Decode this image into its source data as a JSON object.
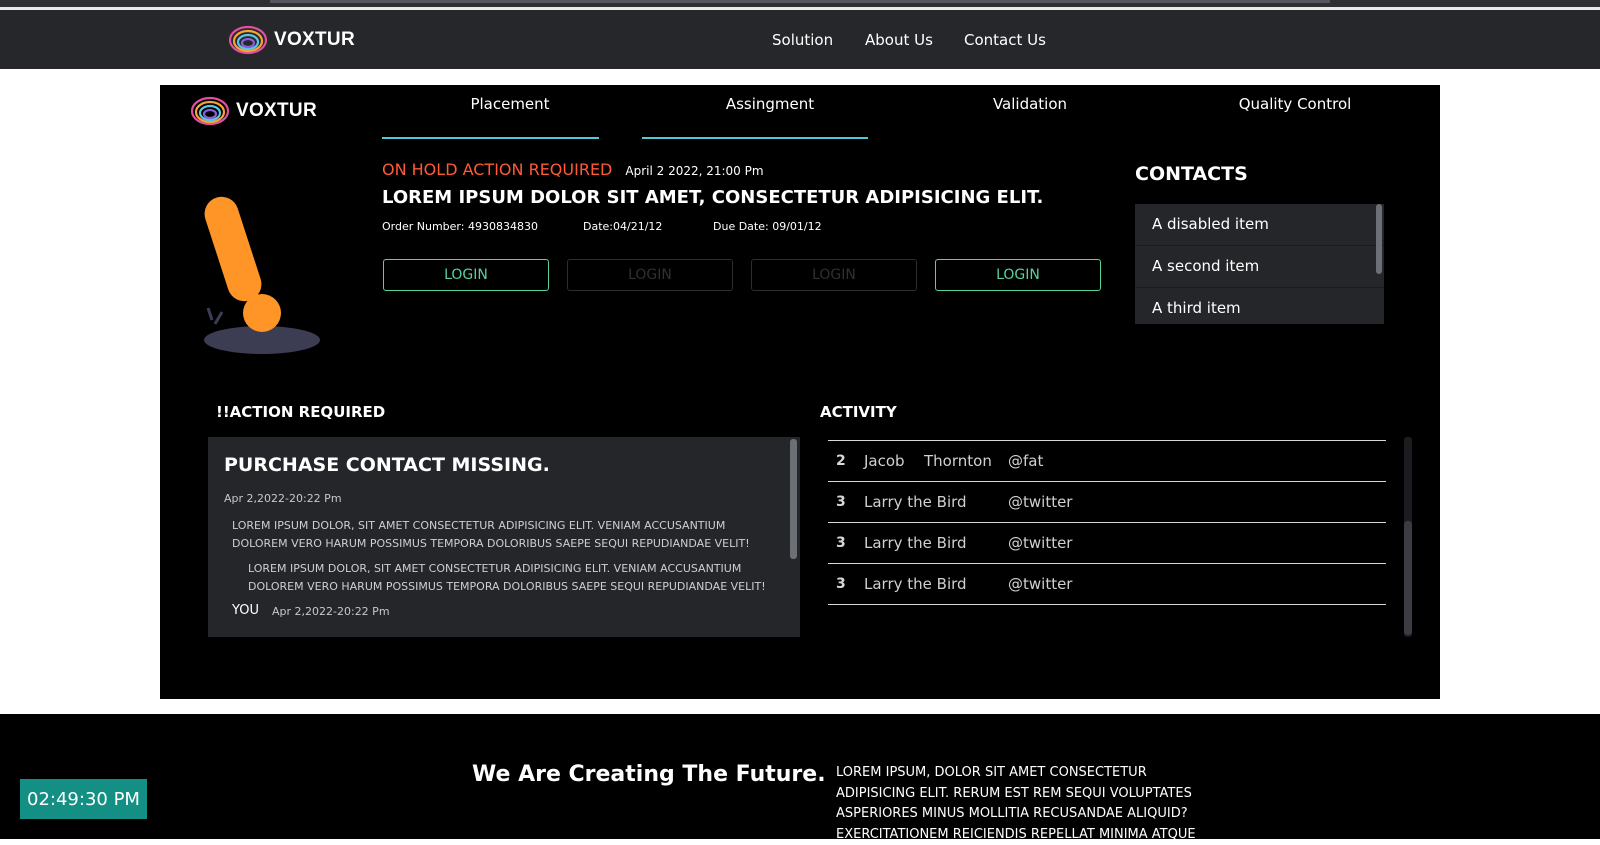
{
  "site": {
    "brand": "VOXTUR",
    "nav": [
      "Solution",
      "About Us",
      "Contact Us"
    ]
  },
  "card": {
    "brand": "VOXTUR",
    "tabs": [
      "Placement",
      "Assingment",
      "Validation",
      "Quality Control"
    ],
    "status": "ON HOLD ACTION REQUIRED",
    "status_time": "April 2 2022, 21:00 Pm",
    "headline": "LOREM IPSUM DOLOR SIT AMET, CONSECTETUR ADIPISICING ELIT.",
    "order_number": "Order Number: 4930834830",
    "date": "Date:04/21/12",
    "due_date": "Due Date: 09/01/12",
    "buttons": [
      {
        "label": "LOGIN",
        "disabled": false
      },
      {
        "label": "LOGIN",
        "disabled": true
      },
      {
        "label": "LOGIN",
        "disabled": true
      },
      {
        "label": "LOGIN",
        "disabled": false
      }
    ],
    "contacts": {
      "title": "CONTACTS",
      "items": [
        "A disabled item",
        "A second item",
        "A third item"
      ]
    },
    "action": {
      "section_title": "!!ACTION REQUIRED",
      "title": "PURCHASE CONTACT MISSING.",
      "timestamp": "Apr 2,2022-20:22 Pm",
      "message1": "LOREM IPSUM DOLOR, SIT AMET CONSECTETUR ADIPISICING ELIT. VENIAM ACCUSANTIUM DOLOREM VERO HARUM POSSIMUS TEMPORA DOLORIBUS SAEPE SEQUI REPUDIANDAE VELIT!",
      "message2": "LOREM IPSUM DOLOR, SIT AMET CONSECTETUR ADIPISICING ELIT. VENIAM ACCUSANTIUM DOLOREM VERO HARUM POSSIMUS TEMPORA DOLORIBUS SAEPE SEQUI REPUDIANDAE VELIT!",
      "reply_author": "YOU",
      "reply_time": "Apr 2,2022-20:22 Pm"
    },
    "activity": {
      "title": "ACTIVITY",
      "rows": [
        {
          "n": "2",
          "first": "Jacob",
          "last": "Thornton",
          "handle": "@fat"
        },
        {
          "n": "3",
          "first": "Larry the Bird",
          "last": "",
          "handle": "@twitter"
        },
        {
          "n": "3",
          "first": "Larry the Bird",
          "last": "",
          "handle": "@twitter"
        },
        {
          "n": "3",
          "first": "Larry the Bird",
          "last": "",
          "handle": "@twitter"
        }
      ]
    }
  },
  "footer": {
    "tagline": "We Are Creating The Future.",
    "body": "LOREM IPSUM, DOLOR SIT AMET CONSECTETUR ADIPISICING ELIT. RERUM EST REM SEQUI VOLUPTATES ASPERIORES MINUS MOLLITIA RECUSANDAE ALIQUID? EXERCITATIONEM REICIENDIS REPELLAT MINIMA ATQUE",
    "clock": "02:49:30 PM"
  },
  "colors": {
    "accent": "#4ecbd4",
    "warning": "#ff5a36",
    "success": "#5ad19c",
    "clock_bg": "#138f84",
    "illustration": "#ff9526"
  },
  "icons": [
    "voxtur-logo-icon",
    "exclamation-illustration-icon"
  ]
}
